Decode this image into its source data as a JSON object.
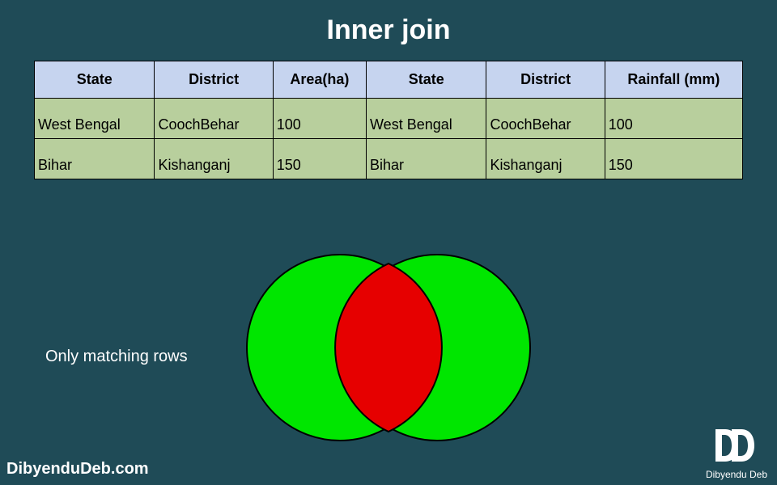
{
  "title": "Inner join",
  "table": {
    "headers": [
      "State",
      "District",
      "Area(ha)",
      "State",
      "District",
      "Rainfall (mm)"
    ],
    "rows": [
      [
        "West Bengal",
        "CoochBehar",
        "100",
        "West Bengal",
        "CoochBehar",
        "100"
      ],
      [
        "Bihar",
        "Kishanganj",
        "150",
        "Bihar",
        "Kishanganj",
        "150"
      ]
    ]
  },
  "caption": "Only matching rows",
  "footer": {
    "site": "DibyenduDeb.com",
    "author": "Dibyendu Deb"
  },
  "colors": {
    "bg": "#1f4b57",
    "header_bg": "#c6d4ef",
    "cell_bg": "#b8cf9d",
    "venn_circle": "#00e600",
    "venn_overlap": "#e60000"
  }
}
